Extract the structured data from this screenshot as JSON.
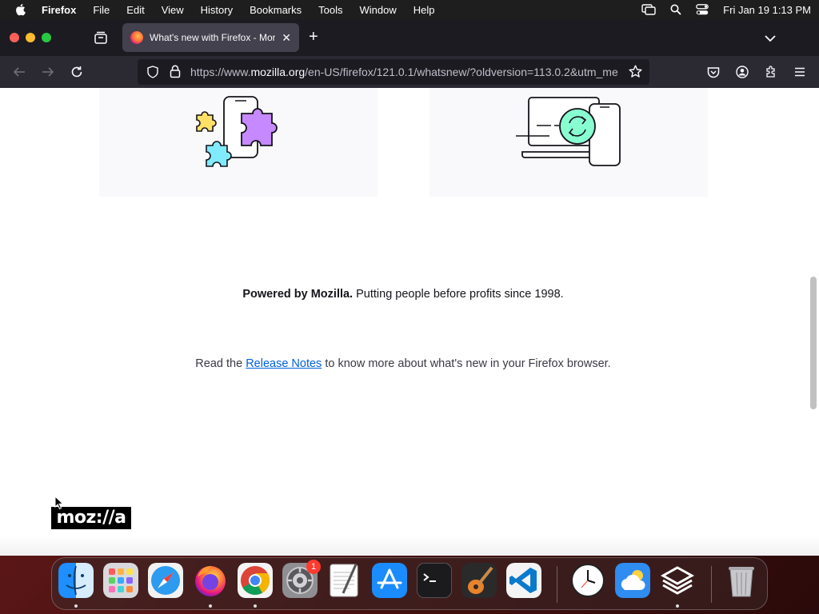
{
  "menubar": {
    "app_name": "Firefox",
    "items": [
      "File",
      "Edit",
      "View",
      "History",
      "Bookmarks",
      "Tools",
      "Window",
      "Help"
    ],
    "clock": "Fri Jan 19  1:13 PM"
  },
  "tab": {
    "title": "What's new with Firefox - More"
  },
  "urlbar": {
    "url_prefix": "https://www.",
    "url_domain": "mozilla.org",
    "url_rest": "/en-US/firefox/121.0.1/whatsnew/?oldversion=113.0.2&utm_me"
  },
  "content": {
    "powered_bold": "Powered by Mozilla.",
    "powered_rest": " Putting people before profits since 1998.",
    "release_before": "Read the ",
    "release_link": "Release Notes",
    "release_after": " to know more about what's new in your Firefox browser.",
    "logo_text": "moz://a"
  },
  "dock": {
    "badge_count": "1",
    "apps": [
      "finder",
      "launchpad",
      "safari",
      "firefox",
      "chrome",
      "system-settings",
      "textedit",
      "app-store",
      "terminal",
      "garageband",
      "vscode",
      "clock",
      "weather",
      "app",
      "trash"
    ]
  },
  "colors": {
    "accent_link": "#0060df",
    "toolbar": "#2b2a33",
    "tabstrip": "#1c1b22"
  }
}
